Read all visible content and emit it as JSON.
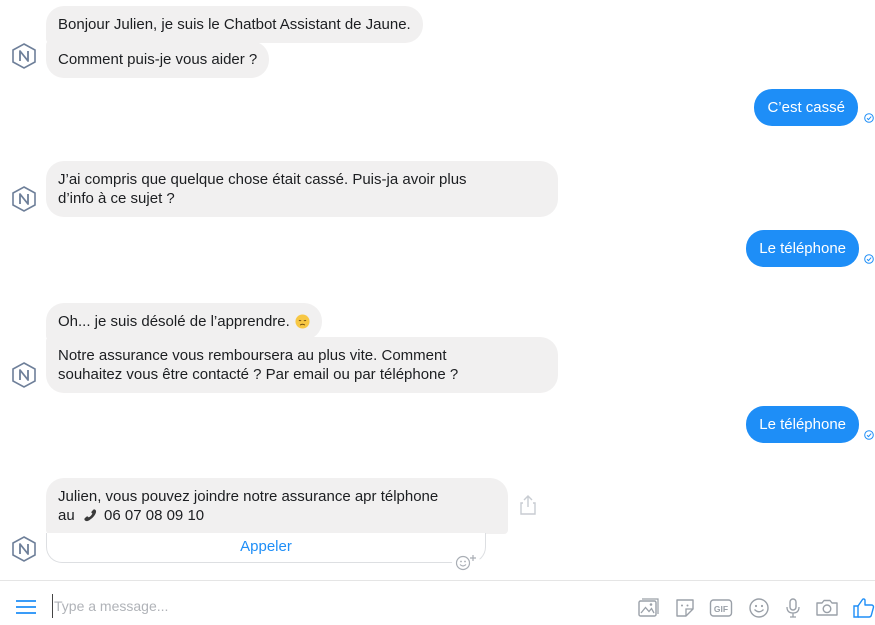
{
  "conversation": {
    "bot_avatar": "bot-logo-icon",
    "messages": [
      {
        "from": "bot",
        "text": "Bonjour Julien, je suis le Chatbot Assistant de Jaune."
      },
      {
        "from": "bot",
        "text": "Comment puis-je vous aider ?"
      },
      {
        "from": "user",
        "text": "C’est cassé"
      },
      {
        "from": "bot",
        "line1": "J’ai compris que quelque chose était cassé. Puis-ja avoir plus",
        "line2": "d’info à ce sujet ?"
      },
      {
        "from": "user",
        "text": "Le téléphone"
      },
      {
        "from": "bot",
        "text": "Oh... je suis désolé de l’apprendre.",
        "emoji": "disappointed-face-emoji"
      },
      {
        "from": "bot",
        "line1": "Notre assurance vous remboursera au plus vite. Comment",
        "line2": "souhaitez vous être contacté ? Par email ou par téléphone ?"
      },
      {
        "from": "user",
        "text": "Le téléphone"
      },
      {
        "from": "bot",
        "line1": "Julien, vous pouvez joindre notre assurance apr télphone",
        "line2_prefix": "au",
        "phone_icon": "telephone-receiver-icon",
        "phone_number": "06 07 08 09 10"
      }
    ],
    "call_button_label": "Appeler",
    "seen_icon": "seen-check-icon"
  },
  "composer": {
    "placeholder": "Type a message...",
    "icons": [
      "menu-icon",
      "photo-icon",
      "sticker-icon",
      "gif-icon",
      "emoji-icon",
      "microphone-icon",
      "camera-icon",
      "like-thumb-icon"
    ]
  },
  "colors": {
    "accent": "#1e8ef7",
    "incoming_bubble": "#f1f0f0",
    "text": "#1c1e21",
    "icon_gray": "#9aa0a8"
  }
}
